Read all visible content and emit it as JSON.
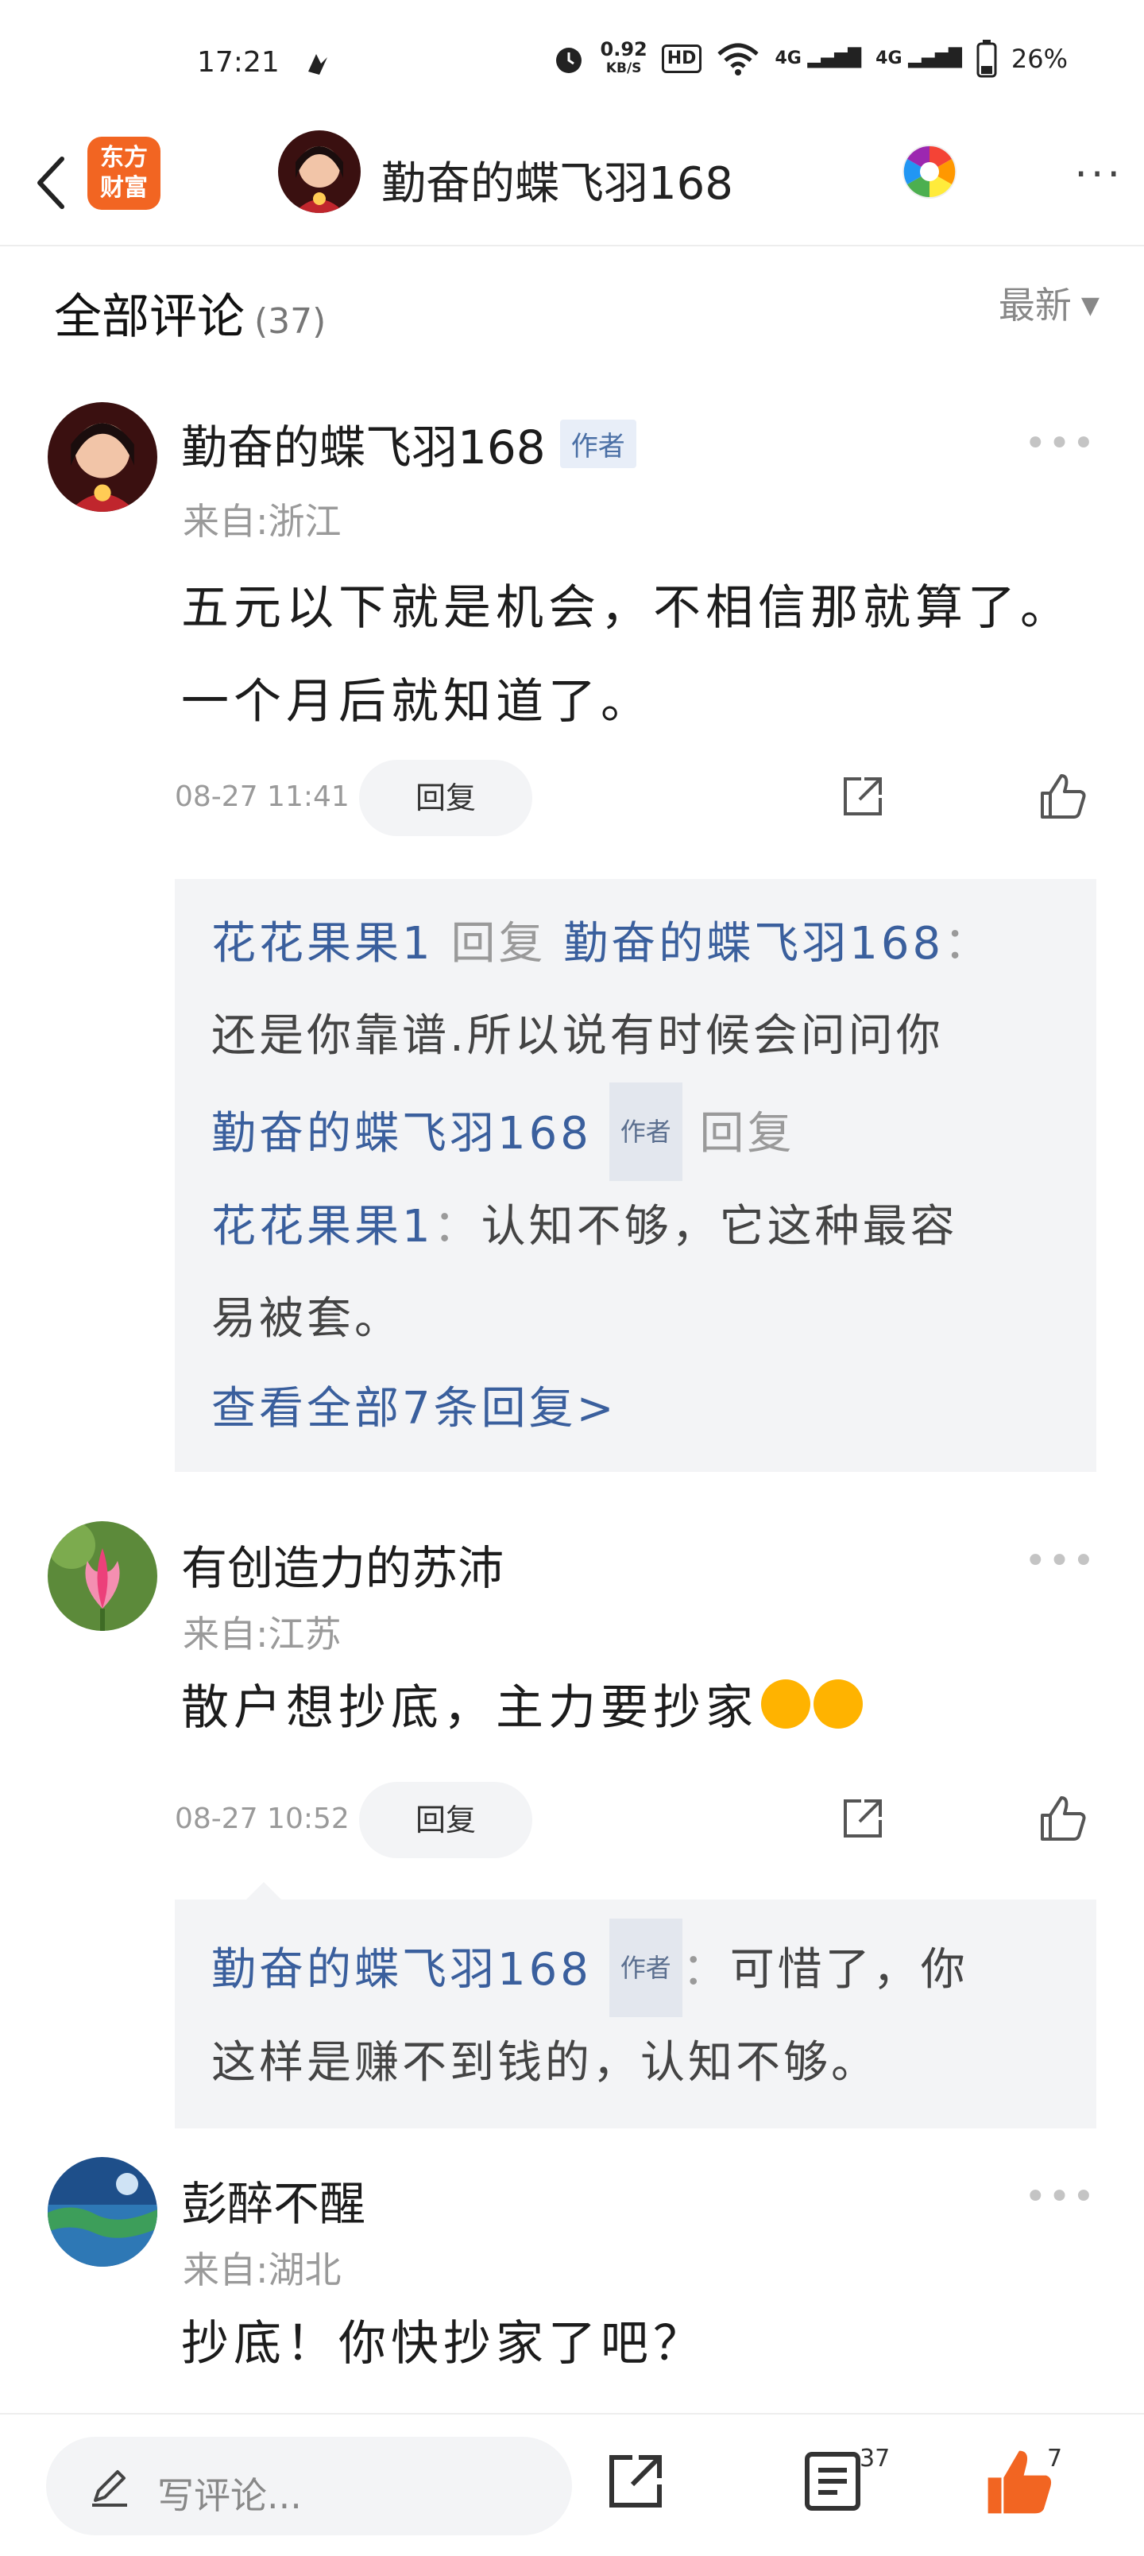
{
  "status_bar": {
    "time": "17:21",
    "net_speed": "0.92",
    "net_unit": "KB/S",
    "hd_label": "HD",
    "signal1": "4G",
    "signal2": "4G",
    "battery": "26%"
  },
  "nav": {
    "logo_line1": "东方",
    "logo_line2": "财富",
    "title": "勤奋的蝶飞羽168",
    "more": "···"
  },
  "list_header": {
    "title": "全部评论",
    "count": "(37)",
    "sort_label": "最新"
  },
  "comments": [
    {
      "name": "勤奋的蝶飞羽168",
      "badge": "作者",
      "location": "来自:浙江",
      "text": "五元以下就是机会，不相信那就算了。一个月后就知道了。",
      "time": "08-27 11:41",
      "reply_label": "回复",
      "replies": {
        "r1_from": "花花果果1",
        "r1_mid": " 回复 ",
        "r1_to": "勤奋的蝶飞羽168",
        "r1_sep": "：",
        "r1_text": "还是你靠谱.所以说有时候会问问你",
        "r2_from": "勤奋的蝶飞羽168",
        "r2_badge": "作者",
        "r2_mid": " 回复",
        "r2_to": "花花果果1",
        "r2_sep": "：",
        "r2_text1": "认知不够，它这种最容",
        "r2_text2": "易被套。",
        "view_all": "查看全部7条回复>"
      }
    },
    {
      "name": "有创造力的苏沛",
      "location": "来自:江苏",
      "text": "散户想抄底，主力要抄家",
      "time": "08-27 10:52",
      "reply_label": "回复",
      "replies": {
        "r1_from": "勤奋的蝶飞羽168",
        "r1_badge": "作者",
        "r1_sep": "：",
        "r1_text1": "可惜了，你",
        "r1_text2": "这样是赚不到钱的，认知不够。"
      }
    },
    {
      "name": "彭醉不醒",
      "location": "来自:湖北",
      "text": "抄底！你快抄家了吧？"
    }
  ],
  "bottom_bar": {
    "input_placeholder": "写评论...",
    "comment_count": "37",
    "like_count": "7"
  },
  "colors": {
    "brand_orange": "#f26522",
    "link_blue": "#3a5f9d",
    "reply_bg": "#f3f4f6"
  }
}
